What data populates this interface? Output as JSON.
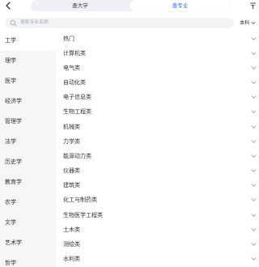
{
  "header": {
    "tabs": [
      {
        "label": "查大学"
      },
      {
        "label": "查专业"
      }
    ],
    "active_tab": 1
  },
  "search": {
    "placeholder": "搜索专业名称",
    "degree_label": "本科"
  },
  "sidebar": {
    "items": [
      {
        "label": "工学"
      },
      {
        "label": "理学"
      },
      {
        "label": "医学"
      },
      {
        "label": "经济学"
      },
      {
        "label": "管理学"
      },
      {
        "label": "法学"
      },
      {
        "label": "历史学"
      },
      {
        "label": "教育学"
      },
      {
        "label": "农学"
      },
      {
        "label": "文学"
      },
      {
        "label": "艺术学"
      },
      {
        "label": "哲学"
      }
    ],
    "active_index": 0
  },
  "categories": {
    "items": [
      {
        "label": "热门"
      },
      {
        "label": "计算机类"
      },
      {
        "label": "电气类"
      },
      {
        "label": "自动化类"
      },
      {
        "label": "电子信息类"
      },
      {
        "label": "生物工程类"
      },
      {
        "label": "机械类"
      },
      {
        "label": "力学类"
      },
      {
        "label": "能源动力类"
      },
      {
        "label": "仪器类"
      },
      {
        "label": "建筑类"
      },
      {
        "label": "化工与制药类"
      },
      {
        "label": "生物医学工程类"
      },
      {
        "label": "土木类"
      },
      {
        "label": "测绘类"
      },
      {
        "label": "水利类"
      }
    ]
  },
  "colors": {
    "accent": "#2f6fe5",
    "sidebar_bg": "#f5f6f8",
    "segment_bg": "#eef0f4"
  },
  "icons": {
    "back": "chevron-left-icon",
    "filter": "filter-icon",
    "search": "search-icon",
    "expand": "chevron-down-icon"
  }
}
